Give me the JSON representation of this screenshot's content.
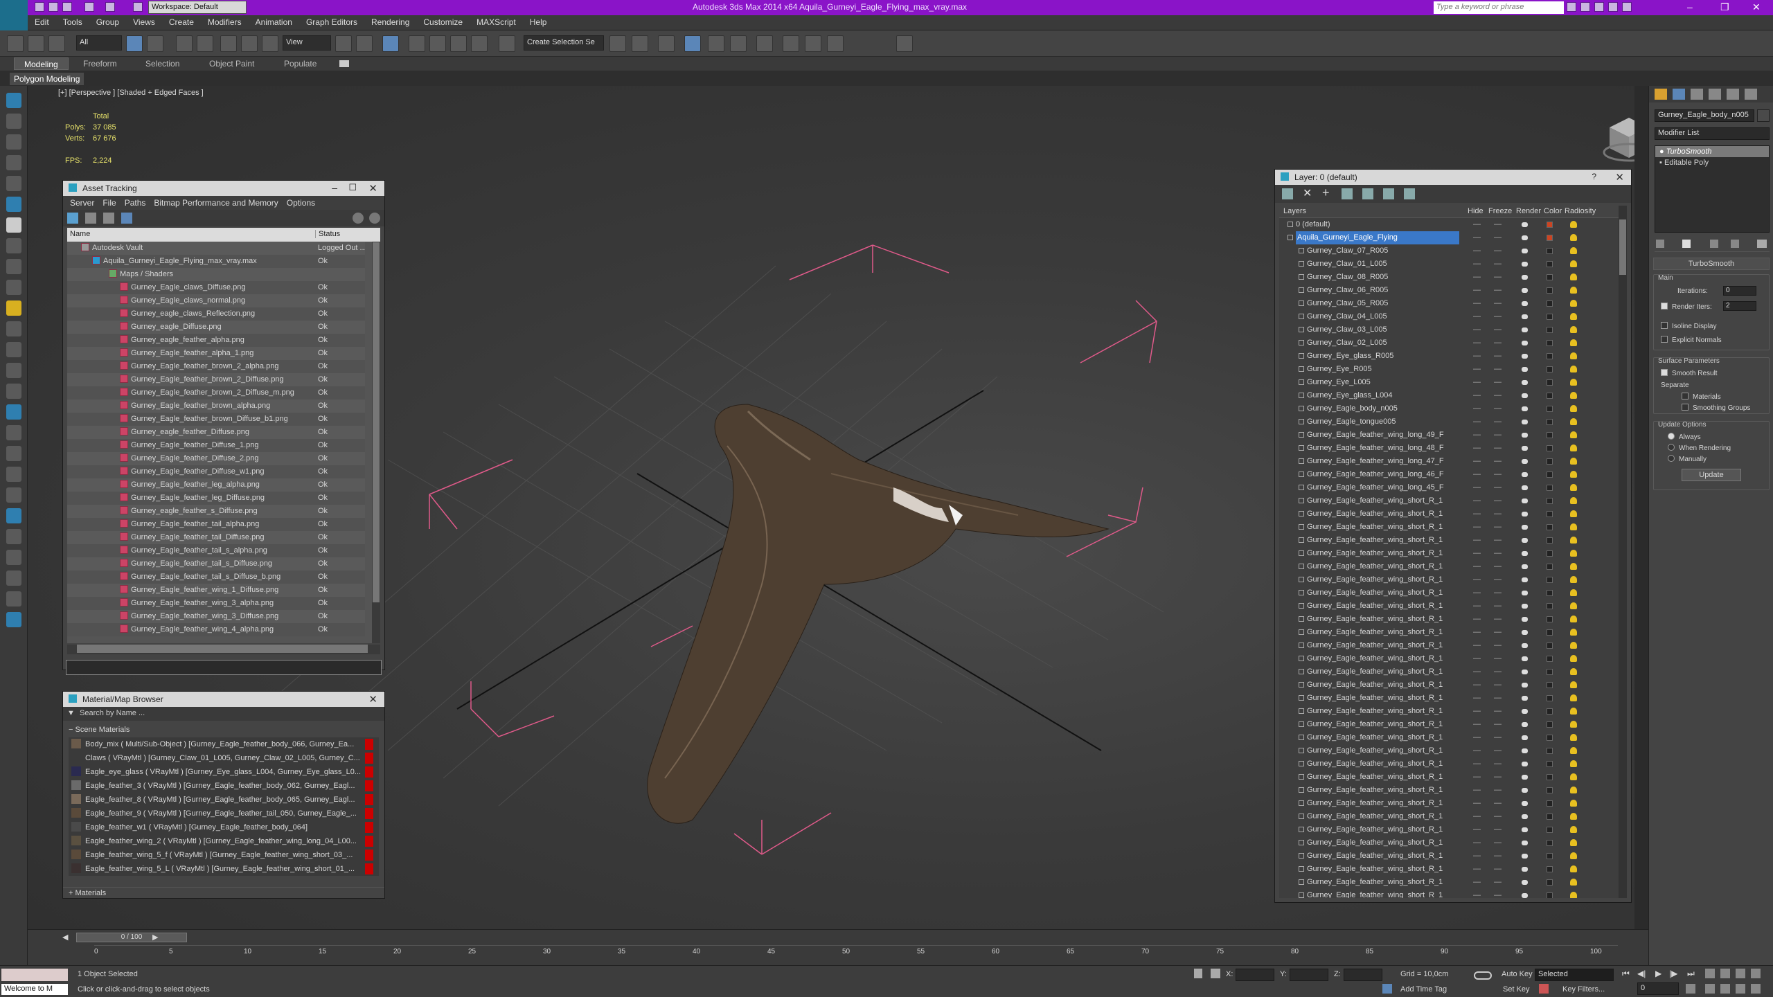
{
  "app": {
    "title": "Autodesk 3ds Max  2014 x64     Aquila_Gurneyi_Eagle_Flying_max_vray.max",
    "workspace": "Workspace: Default",
    "search_placeholder": "Type a keyword or phrase"
  },
  "menu": [
    "Edit",
    "Tools",
    "Group",
    "Views",
    "Create",
    "Modifiers",
    "Animation",
    "Graph Editors",
    "Rendering",
    "Customize",
    "MAXScript",
    "Help"
  ],
  "toolbar": {
    "filter": "All",
    "refcoord": "View",
    "named_selection": "Create Selection Se"
  },
  "ribbon": {
    "tabs": [
      "Modeling",
      "Freeform",
      "Selection",
      "Object Paint",
      "Populate"
    ],
    "sub": "Polygon Modeling"
  },
  "viewport": {
    "label": "[+] [Perspective ] [Shaded + Edged Faces ]",
    "stats": {
      "total": "Total",
      "polys_label": "Polys:",
      "polys": "37 085",
      "verts_label": "Verts:",
      "verts": "67 676",
      "fps_label": "FPS:",
      "fps": "2,224"
    }
  },
  "asset_tracking": {
    "title": "Asset Tracking",
    "menu": [
      "Server",
      "File",
      "Paths",
      "Bitmap Performance and Memory",
      "Options"
    ],
    "col_name": "Name",
    "col_status": "Status",
    "rows": [
      {
        "name": "Autodesk Vault",
        "status": "Logged Out ..."
      },
      {
        "name": "Aquila_Gurneyi_Eagle_Flying_max_vray.max",
        "status": "Ok"
      },
      {
        "name": "Maps / Shaders",
        "status": ""
      },
      {
        "name": "Gurney_Eagle_claws_Diffuse.png",
        "status": "Ok"
      },
      {
        "name": "Gurney_Eagle_claws_normal.png",
        "status": "Ok"
      },
      {
        "name": "Gurney_eagle_claws_Reflection.png",
        "status": "Ok"
      },
      {
        "name": "Gurney_eagle_Diffuse.png",
        "status": "Ok"
      },
      {
        "name": "Gurney_eagle_feather_alpha.png",
        "status": "Ok"
      },
      {
        "name": "Gurney_Eagle_feather_alpha_1.png",
        "status": "Ok"
      },
      {
        "name": "Gurney_Eagle_feather_brown_2_alpha.png",
        "status": "Ok"
      },
      {
        "name": "Gurney_Eagle_feather_brown_2_Diffuse.png",
        "status": "Ok"
      },
      {
        "name": "Gurney_Eagle_feather_brown_2_Diffuse_m.png",
        "status": "Ok"
      },
      {
        "name": "Gurney_Eagle_feather_brown_alpha.png",
        "status": "Ok"
      },
      {
        "name": "Gurney_Eagle_feather_brown_Diffuse_b1.png",
        "status": "Ok"
      },
      {
        "name": "Gurney_eagle_feather_Diffuse.png",
        "status": "Ok"
      },
      {
        "name": "Gurney_Eagle_feather_Diffuse_1.png",
        "status": "Ok"
      },
      {
        "name": "Gurney_Eagle_feather_Diffuse_2.png",
        "status": "Ok"
      },
      {
        "name": "Gurney_Eagle_feather_Diffuse_w1.png",
        "status": "Ok"
      },
      {
        "name": "Gurney_Eagle_feather_leg_alpha.png",
        "status": "Ok"
      },
      {
        "name": "Gurney_Eagle_feather_leg_Diffuse.png",
        "status": "Ok"
      },
      {
        "name": "Gurney_eagle_feather_s_Diffuse.png",
        "status": "Ok"
      },
      {
        "name": "Gurney_Eagle_feather_tail_alpha.png",
        "status": "Ok"
      },
      {
        "name": "Gurney_Eagle_feather_tail_Diffuse.png",
        "status": "Ok"
      },
      {
        "name": "Gurney_Eagle_feather_tail_s_alpha.png",
        "status": "Ok"
      },
      {
        "name": "Gurney_Eagle_feather_tail_s_Diffuse.png",
        "status": "Ok"
      },
      {
        "name": "Gurney_Eagle_feather_tail_s_Diffuse_b.png",
        "status": "Ok"
      },
      {
        "name": "Gurney_Eagle_feather_wing_1_Diffuse.png",
        "status": "Ok"
      },
      {
        "name": "Gurney_Eagle_feather_wing_3_alpha.png",
        "status": "Ok"
      },
      {
        "name": "Gurney_Eagle_feather_wing_3_Diffuse.png",
        "status": "Ok"
      },
      {
        "name": "Gurney_Eagle_feather_wing_4_alpha.png",
        "status": "Ok"
      }
    ]
  },
  "material_browser": {
    "title": "Material/Map Browser",
    "search_placeholder": "Search by Name ...",
    "section": "Scene Materials",
    "footer_section": "Materials",
    "rows": [
      "Body_mix  ( Multi/Sub-Object )  [Gurney_Eagle_feather_body_066, Gurney_Ea...",
      "Claws  ( VRayMtl )  [Gurney_Claw_01_L005, Gurney_Claw_02_L005, Gurney_C...",
      "Eagle_eye_glass  ( VRayMtl )  [Gurney_Eye_glass_L004, Gurney_Eye_glass_L0...",
      "Eagle_feather_3  ( VRayMtl )  [Gurney_Eagle_feather_body_062, Gurney_Eagl...",
      "Eagle_feather_8  ( VRayMtl )  [Gurney_Eagle_feather_body_065, Gurney_Eagl...",
      "Eagle_feather_9  ( VRayMtl )  [Gurney_Eagle_feather_tail_050, Gurney_Eagle_...",
      "Eagle_feather_w1  ( VRayMtl )  [Gurney_Eagle_feather_body_064]",
      "Eagle_feather_wing_2  ( VRayMtl )  [Gurney_Eagle_feather_wing_long_04_L00...",
      "Eagle_feather_wing_5_f  ( VRayMtl )  [Gurney_Eagle_feather_wing_short_03_...",
      "Eagle_feather_wing_5_L  ( VRayMtl )  [Gurney_Eagle_feather_wing_short_01_..."
    ]
  },
  "layers": {
    "title": "Layer: 0 (default)",
    "columns": [
      "Layers",
      "Hide",
      "Freeze",
      "Render",
      "Color",
      "Radiosity"
    ],
    "default_layer": "0 (default)",
    "selected_layer": "Aquila_Gurneyi_Eagle_Flying",
    "rows": [
      "Gurney_Claw_07_R005",
      "Gurney_Claw_01_L005",
      "Gurney_Claw_08_R005",
      "Gurney_Claw_06_R005",
      "Gurney_Claw_05_R005",
      "Gurney_Claw_04_L005",
      "Gurney_Claw_03_L005",
      "Gurney_Claw_02_L005",
      "Gurney_Eye_glass_R005",
      "Gurney_Eye_R005",
      "Gurney_Eye_L005",
      "Gurney_Eye_glass_L004",
      "Gurney_Eagle_body_n005",
      "Gurney_Eagle_tongue005",
      "Gurney_Eagle_feather_wing_long_49_F",
      "Gurney_Eagle_feather_wing_long_48_F",
      "Gurney_Eagle_feather_wing_long_47_F",
      "Gurney_Eagle_feather_wing_long_46_F",
      "Gurney_Eagle_feather_wing_long_45_F",
      "Gurney_Eagle_feather_wing_short_R_1",
      "Gurney_Eagle_feather_wing_short_R_1",
      "Gurney_Eagle_feather_wing_short_R_1",
      "Gurney_Eagle_feather_wing_short_R_1",
      "Gurney_Eagle_feather_wing_short_R_1",
      "Gurney_Eagle_feather_wing_short_R_1",
      "Gurney_Eagle_feather_wing_short_R_1",
      "Gurney_Eagle_feather_wing_short_R_1",
      "Gurney_Eagle_feather_wing_short_R_1",
      "Gurney_Eagle_feather_wing_short_R_1",
      "Gurney_Eagle_feather_wing_short_R_1",
      "Gurney_Eagle_feather_wing_short_R_1",
      "Gurney_Eagle_feather_wing_short_R_1",
      "Gurney_Eagle_feather_wing_short_R_1",
      "Gurney_Eagle_feather_wing_short_R_1",
      "Gurney_Eagle_feather_wing_short_R_1",
      "Gurney_Eagle_feather_wing_short_R_1",
      "Gurney_Eagle_feather_wing_short_R_1",
      "Gurney_Eagle_feather_wing_short_R_1",
      "Gurney_Eagle_feather_wing_short_R_1",
      "Gurney_Eagle_feather_wing_short_R_1",
      "Gurney_Eagle_feather_wing_short_R_1",
      "Gurney_Eagle_feather_wing_short_R_1",
      "Gurney_Eagle_feather_wing_short_R_1",
      "Gurney_Eagle_feather_wing_short_R_1",
      "Gurney_Eagle_feather_wing_short_R_1",
      "Gurney_Eagle_feather_wing_short_R_1",
      "Gurney_Eagle_feather_wing_short_R_1",
      "Gurney_Eagle_feather_wing_short_R_1",
      "Gurney_Eagle_feather_wing_short_R_1",
      "Gurney_Eagle_feather_wing_short_R_1"
    ]
  },
  "command_panel": {
    "object_name": "Gurney_Eagle_body_n005",
    "modifier_list": "Modifier List",
    "stack": [
      "TurboSmooth",
      "Editable Poly"
    ],
    "rollout": "TurboSmooth",
    "main": "Main",
    "iterations_label": "Iterations:",
    "iterations": "0",
    "render_iters_label": "Render Iters:",
    "render_iters": "2",
    "isoline": "Isoline Display",
    "explicit_normals": "Explicit Normals",
    "surface_params": "Surface Parameters",
    "smooth_result": "Smooth Result",
    "separate": "Separate",
    "materials": "Materials",
    "smoothing_groups": "Smoothing Groups",
    "update_options": "Update Options",
    "always": "Always",
    "when_rendering": "When Rendering",
    "manually": "Manually",
    "update_button": "Update"
  },
  "timeline": {
    "frame": "0 / 100",
    "ticks": [
      "0",
      "5",
      "10",
      "15",
      "20",
      "25",
      "30",
      "35",
      "40",
      "45",
      "50",
      "55",
      "60",
      "65",
      "70",
      "75",
      "80",
      "85",
      "90",
      "95",
      "100"
    ]
  },
  "status": {
    "welcome": "Welcome to M",
    "selected": "1 Object Selected",
    "prompt": "Click or click-and-drag to select objects",
    "x_label": "X:",
    "y_label": "Y:",
    "z_label": "Z:",
    "grid": "Grid = 10,0cm",
    "auto_key": "Auto Key",
    "selected_set": "Selected",
    "set_key": "Set Key",
    "key_filters": "Key Filters...",
    "add_time_tag": "Add Time Tag",
    "frame": "0"
  }
}
